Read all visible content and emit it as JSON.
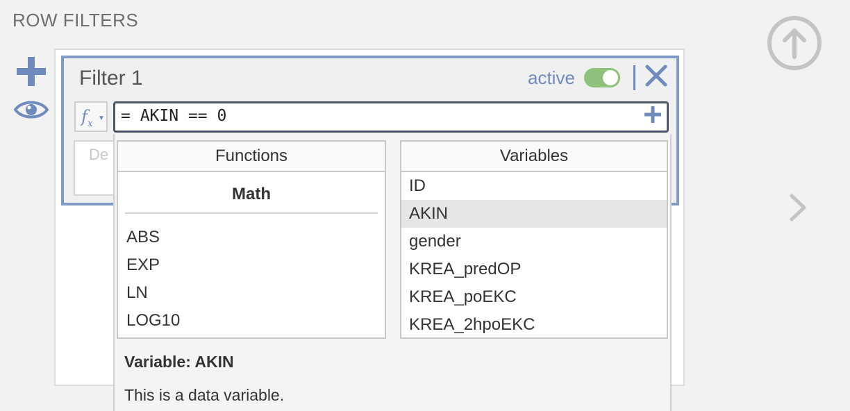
{
  "section": {
    "title": "ROW FILTERS"
  },
  "filter": {
    "name": "Filter 1",
    "active_label": "active",
    "active": true,
    "formula": "= AKIN == 0",
    "description_placeholder": "De"
  },
  "colors": {
    "accent": "#6f8bbd",
    "toggle_on": "#8ec17c",
    "panel_border": "#7f9ac7"
  },
  "functions": {
    "header": "Functions",
    "group": "Math",
    "items": [
      "ABS",
      "EXP",
      "LN",
      "LOG10"
    ]
  },
  "variables": {
    "header": "Variables",
    "items": [
      "ID",
      "AKIN",
      "gender",
      "KREA_predOP",
      "KREA_poEKC",
      "KREA_2hpoEKC"
    ],
    "selected": "AKIN"
  },
  "info": {
    "title": "Variable: AKIN",
    "text": "This is a data variable."
  },
  "icons": {
    "add": "plus-icon",
    "visibility": "eye-icon",
    "upload": "arrow-up-circle-icon",
    "next": "chevron-right-icon",
    "remove": "close-icon",
    "function": "fx-icon"
  }
}
